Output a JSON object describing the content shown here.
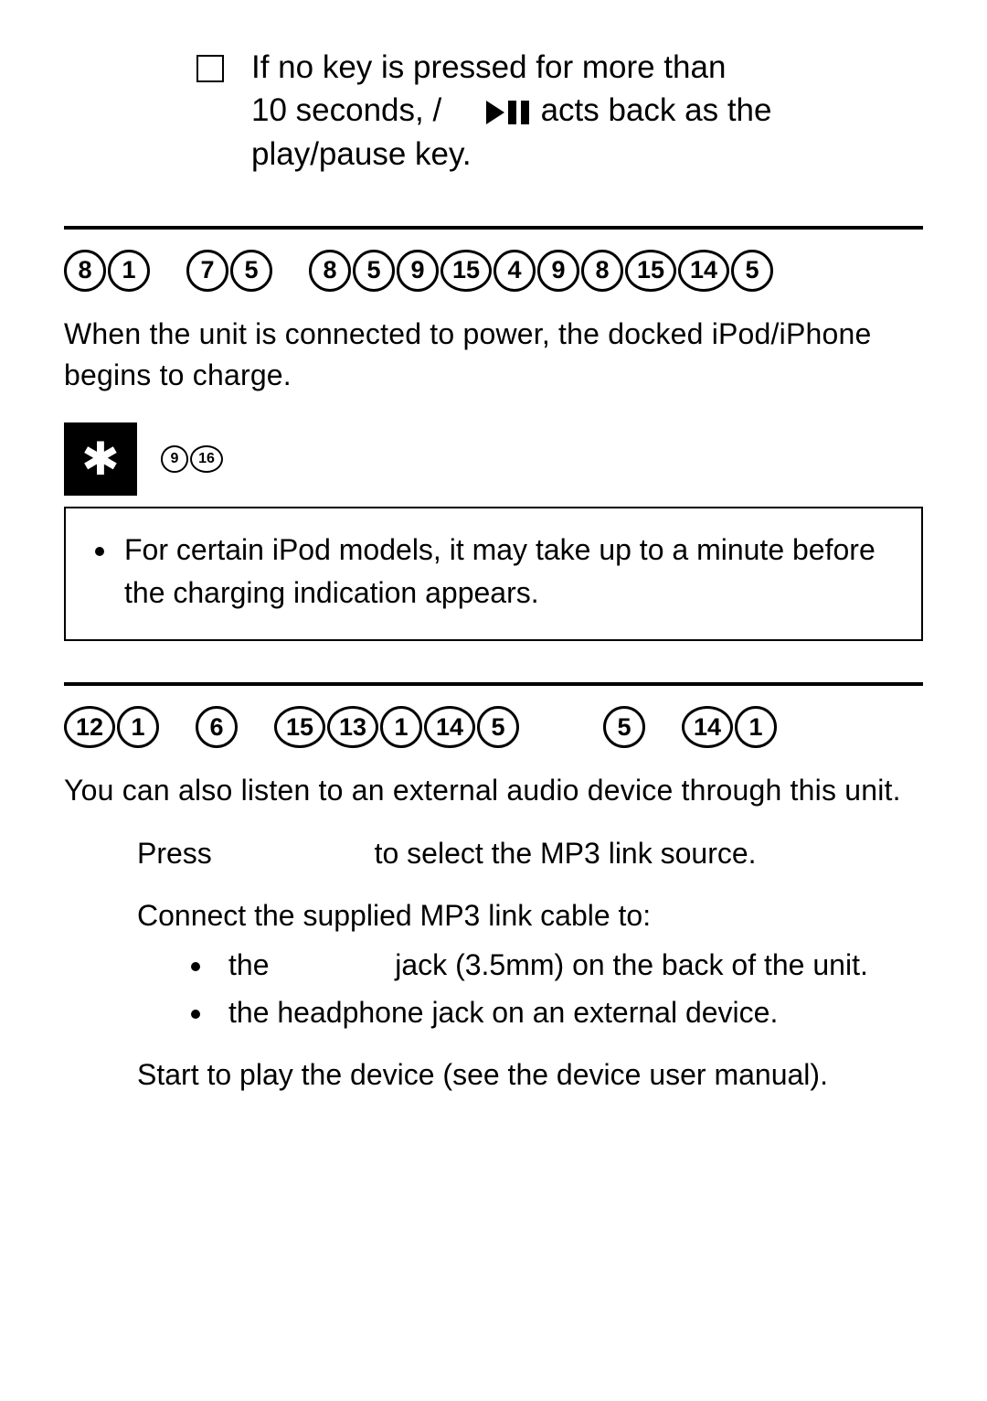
{
  "top_note": {
    "line1_prefix": "If no key is pressed for more than",
    "line2_before_icon": "10 seconds, /",
    "line2_after_icon": " acts back as the",
    "line3": "play/pause key."
  },
  "section_charge": {
    "heading_words": [
      [
        "8",
        "1"
      ],
      [
        "7",
        "5"
      ],
      [
        "8",
        "5",
        "9",
        "15",
        "4",
        "9",
        "8",
        "15",
        "14",
        "5"
      ]
    ],
    "body": "When the unit is connected to power, the docked iPod/iPhone begins to charge."
  },
  "note_block": {
    "label_nums": [
      "9",
      "16"
    ],
    "item": "For certain iPod models, it may take up to a minute before the charging indication appears."
  },
  "section_source": {
    "heading_words": [
      [
        "12",
        "1"
      ],
      [
        "6"
      ],
      [
        "15",
        "13",
        "1",
        "14",
        "5"
      ],
      [
        "5"
      ],
      [
        "14",
        "1"
      ]
    ],
    "body": "You can also listen to an external audio device through this unit."
  },
  "steps": {
    "s1_press": "Press",
    "s1_rest": "to select the MP3 link source.",
    "s2_intro": "Connect the supplied MP3 link cable to:",
    "s2_a_the": "the",
    "s2_a_rest": "jack (3.5mm) on the back of the unit.",
    "s2_b": "the headphone jack on an external device.",
    "s3": "Start to play the device (see the device user manual)."
  }
}
